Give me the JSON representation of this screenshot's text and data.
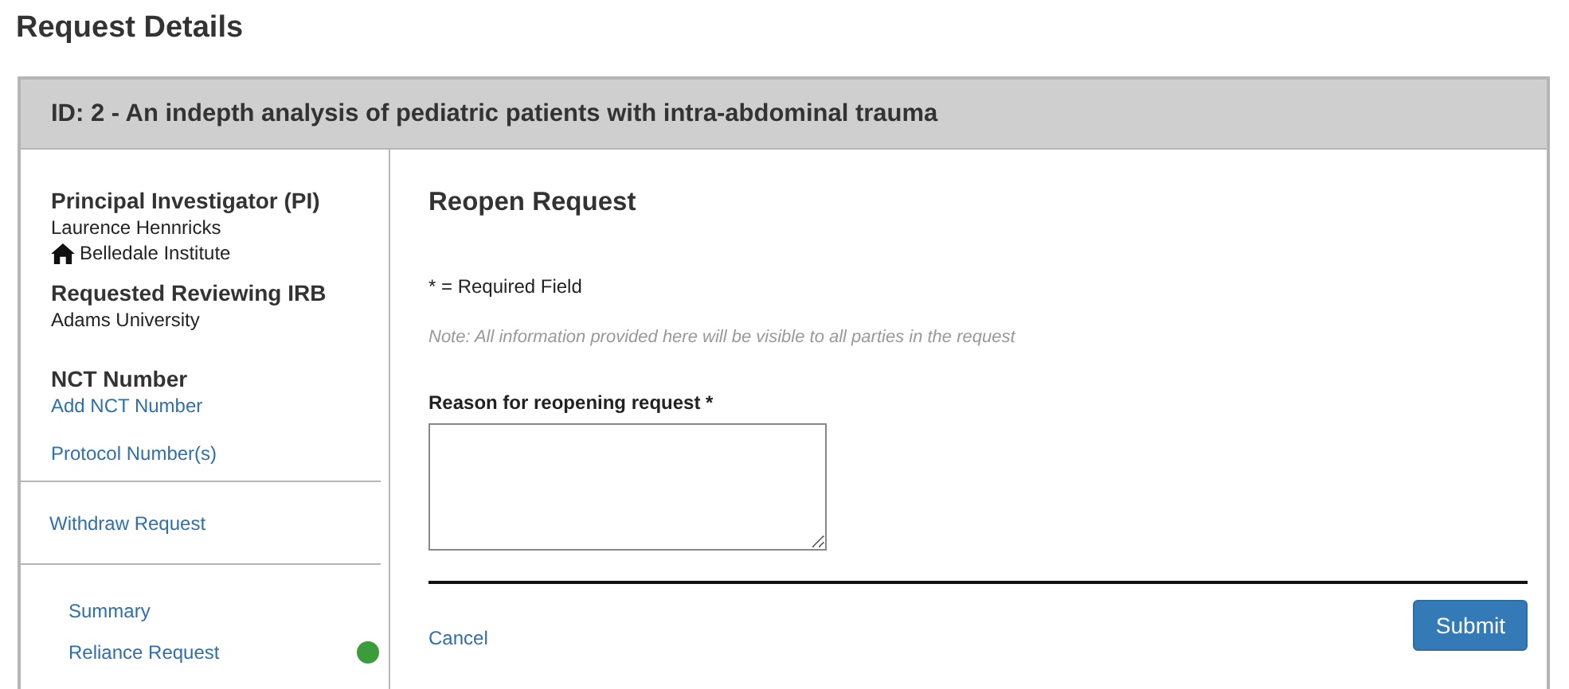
{
  "page_title": "Request Details",
  "request_header": "ID: 2 - An indepth analysis of pediatric patients with intra-abdominal trauma",
  "sidebar": {
    "pi_heading": "Principal Investigator (PI)",
    "pi_name": "Laurence Hennricks",
    "pi_institution": "Belledale Institute",
    "irb_heading": "Requested Reviewing IRB",
    "irb_name": "Adams University",
    "nct_heading": "NCT Number",
    "nct_link": "Add NCT Number",
    "protocol_link": "Protocol Number(s)",
    "withdraw_link": "Withdraw Request",
    "nav_items": [
      {
        "label": "Summary"
      },
      {
        "label": "Reliance Request",
        "color": "#3a9c3a"
      }
    ]
  },
  "form": {
    "title": "Reopen Request",
    "required_note": "* = Required Field",
    "visibility_note": "Note: All information provided here will be visible to all parties in the request",
    "reason_label": "Reason for reopening request *",
    "cancel": "Cancel",
    "submit": "Submit"
  }
}
